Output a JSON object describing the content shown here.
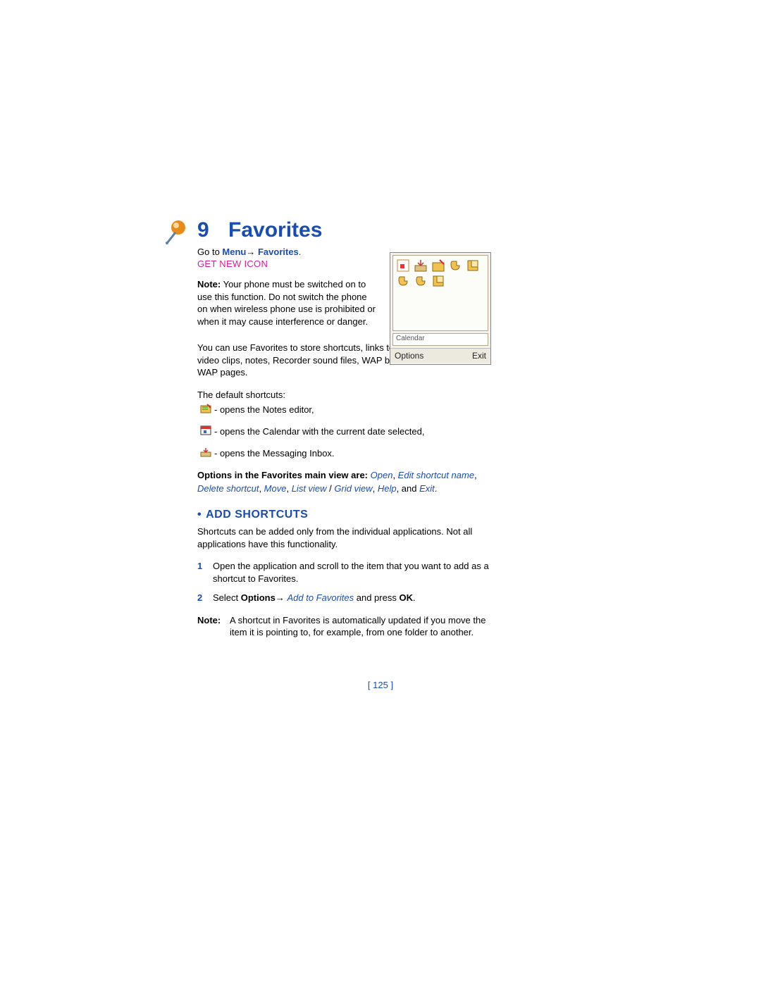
{
  "chapter": {
    "number": "9",
    "title": "Favorites"
  },
  "goto": {
    "prefix": "Go to ",
    "menu": "Menu",
    "arrow": "→",
    "dest": " Favorites",
    "suffix": "."
  },
  "getnewicon": "GET NEW ICON",
  "note1": {
    "label": "Note:",
    "text": "  Your phone must be switched on to use this function. Do not switch the phone on when wireless phone use is prohibited or when it may cause interference or danger."
  },
  "intro": "You can use Favorites to store shortcuts, links to your favorite photos, video clips, notes, Recorder sound files, WAP bookmarks, and saved WAP pages.",
  "defaults_lead": "The default shortcuts:",
  "defaults": [
    " - opens the Notes editor,",
    " - opens the Calendar with the current date selected,",
    " - opens the Messaging Inbox."
  ],
  "options": {
    "lead": "Options in the Favorites main view are: ",
    "items": [
      "Open",
      "Edit shortcut name",
      "Delete shortcut",
      "Move",
      "List view",
      "Grid view",
      "Help",
      "Exit"
    ],
    "sep_comma": ", ",
    "sep_slash": " / ",
    "tail_and": ", and ",
    "tail_period": "."
  },
  "section": {
    "bullet": "•",
    "title": "ADD SHORTCUTS"
  },
  "section_intro": "Shortcuts can be added only from the individual applications. Not all applications have this functionality.",
  "steps": [
    {
      "n": "1",
      "parts": [
        {
          "t": "Open the application and scroll to the item that you want to add as a shortcut to Favorites.",
          "cls": ""
        }
      ]
    },
    {
      "n": "2",
      "parts": [
        {
          "t": "Select ",
          "cls": ""
        },
        {
          "t": "Options",
          "cls": "step-bold"
        },
        {
          "t": "→ ",
          "cls": "arrow"
        },
        {
          "t": "Add to Favorites",
          "cls": "step-blue-ital"
        },
        {
          "t": " and press ",
          "cls": ""
        },
        {
          "t": "OK",
          "cls": "step-bold"
        },
        {
          "t": ".",
          "cls": ""
        }
      ]
    }
  ],
  "note2": {
    "label": "Note:",
    "text": "A shortcut in Favorites is automatically updated if you move the item it is pointing to, for example, from one folder to another."
  },
  "pagenum": "[ 125 ]",
  "screenshot": {
    "label": "Calendar",
    "left_softkey": "Options",
    "right_softkey": "Exit"
  }
}
